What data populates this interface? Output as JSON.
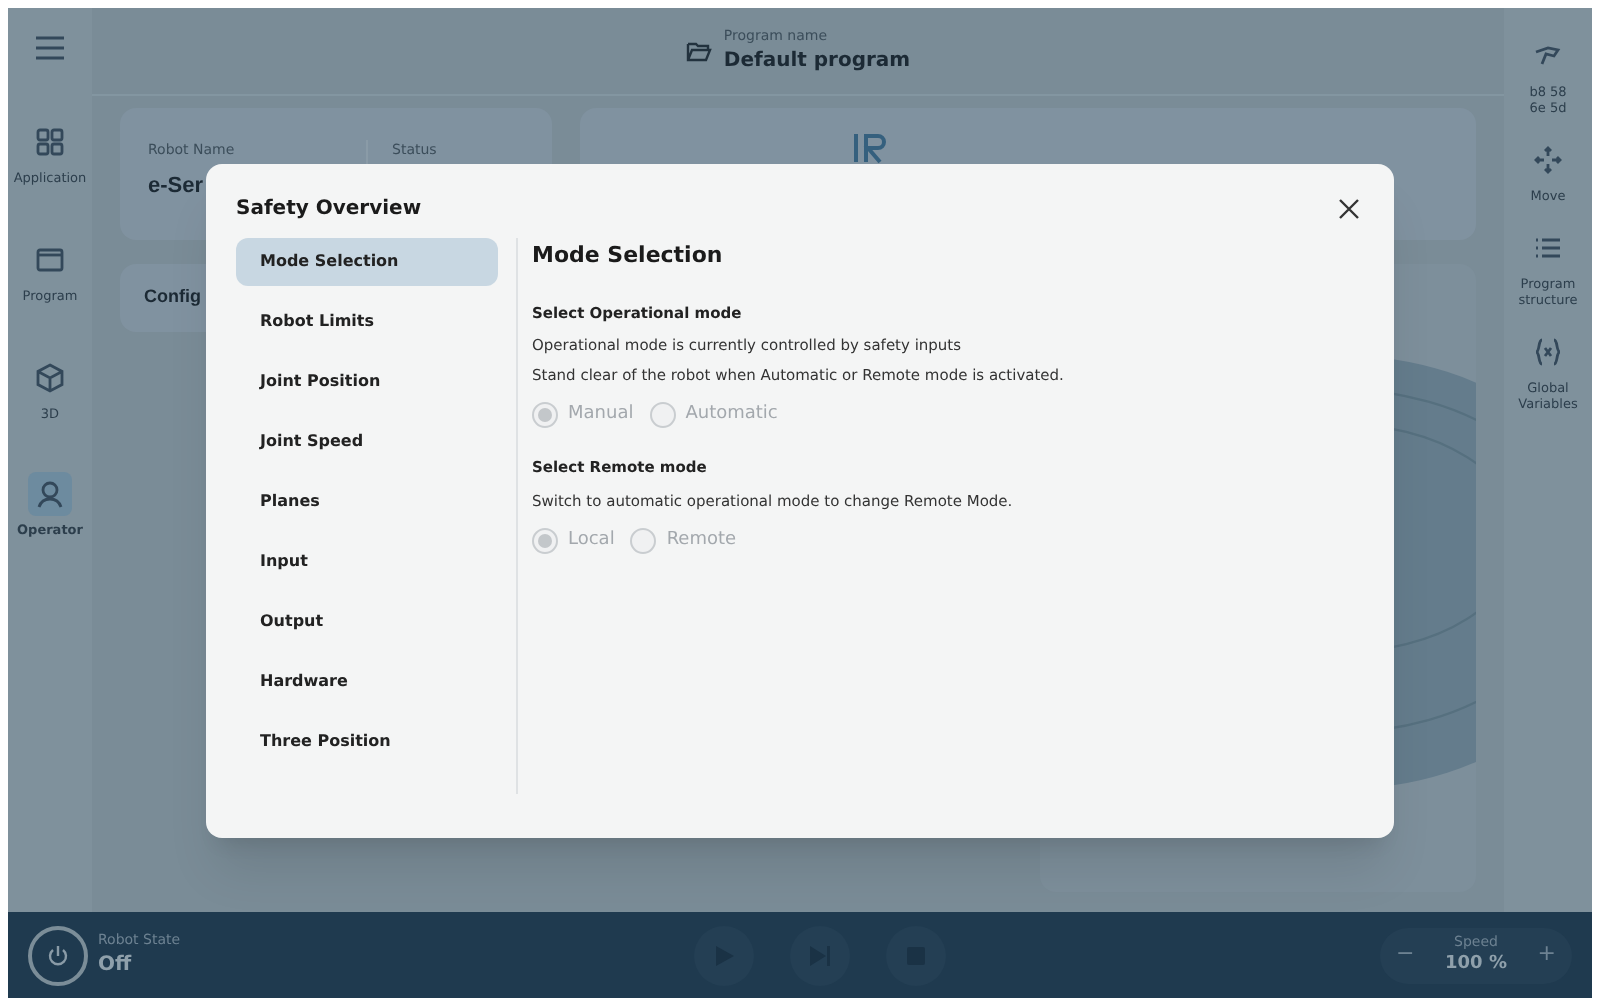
{
  "header": {
    "label": "Program name",
    "title": "Default program"
  },
  "left_nav": [
    {
      "label": "Application",
      "selected": false
    },
    {
      "label": "Program",
      "selected": false
    },
    {
      "label": "3D",
      "selected": false
    },
    {
      "label": "Operator",
      "selected": true
    }
  ],
  "right_nav": [
    {
      "label": "b8 58\n6e 5d"
    },
    {
      "label": "Move"
    },
    {
      "label": "Program structure"
    },
    {
      "label": "Global Variables"
    }
  ],
  "robot_card": {
    "name_label": "Robot Name",
    "name_value": "e-Ser",
    "status_label": "Status"
  },
  "config_card": {
    "title": "Config"
  },
  "dialog": {
    "title": "Safety Overview",
    "nav": [
      {
        "label": "Mode Selection",
        "selected": true
      },
      {
        "label": "Robot Limits",
        "selected": false
      },
      {
        "label": "Joint Position",
        "selected": false
      },
      {
        "label": "Joint Speed",
        "selected": false
      },
      {
        "label": "Planes",
        "selected": false
      },
      {
        "label": "Input",
        "selected": false
      },
      {
        "label": "Output",
        "selected": false
      },
      {
        "label": "Hardware",
        "selected": false
      },
      {
        "label": "Three Position",
        "selected": false
      }
    ],
    "heading": "Mode Selection",
    "sections": [
      {
        "title": "Select Operational mode",
        "lines": [
          "Operational mode is currently controlled by safety inputs",
          "Stand clear of the robot when Automatic or Remote mode is activated."
        ],
        "options": [
          {
            "label": "Manual",
            "selected": true,
            "disabled": true
          },
          {
            "label": "Automatic",
            "selected": false,
            "disabled": true
          }
        ]
      },
      {
        "title": "Select Remote mode",
        "lines": [
          "Switch to automatic operational mode to change Remote Mode."
        ],
        "options": [
          {
            "label": "Local",
            "selected": true,
            "disabled": true
          },
          {
            "label": "Remote",
            "selected": false,
            "disabled": true
          }
        ]
      }
    ]
  },
  "bottom_bar": {
    "state_label": "Robot State",
    "state_value": "Off",
    "speed_label": "Speed",
    "speed_value": "100 %",
    "minus": "−",
    "plus": "+"
  }
}
